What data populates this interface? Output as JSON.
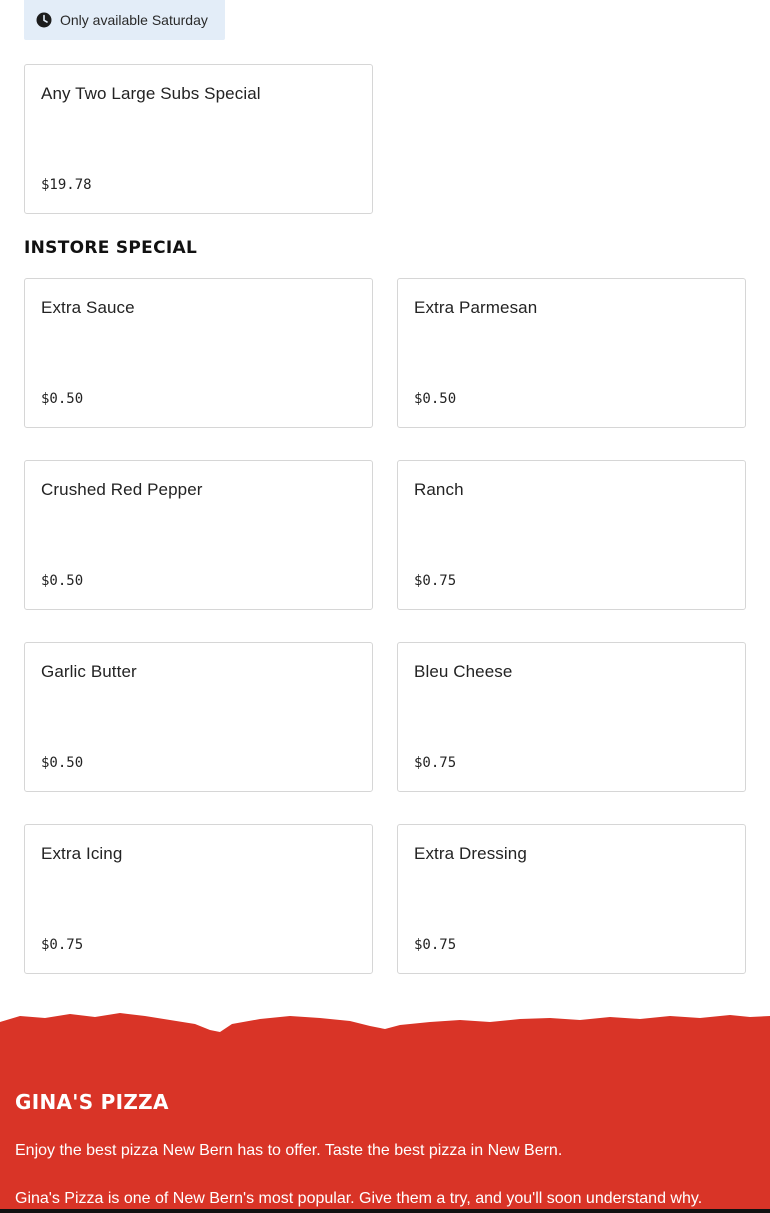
{
  "availability": {
    "icon": "clock-icon",
    "text": "Only available Saturday"
  },
  "special_items": [
    {
      "name": "Any Two Large Subs Special",
      "price": "$19.78"
    }
  ],
  "instore_section": {
    "title": "INSTORE SPECIAL",
    "items": [
      {
        "name": "Extra Sauce",
        "price": "$0.50"
      },
      {
        "name": "Extra Parmesan",
        "price": "$0.50"
      },
      {
        "name": "Crushed Red Pepper",
        "price": "$0.50"
      },
      {
        "name": "Ranch",
        "price": "$0.75"
      },
      {
        "name": "Garlic Butter",
        "price": "$0.50"
      },
      {
        "name": "Bleu Cheese",
        "price": "$0.75"
      },
      {
        "name": "Extra Icing",
        "price": "$0.75"
      },
      {
        "name": "Extra Dressing",
        "price": "$0.75"
      }
    ]
  },
  "footer": {
    "brand": "GINA'S PIZZA",
    "tagline": "Enjoy the best pizza New Bern has to offer. Taste the best pizza in New Bern.",
    "description": "Gina's Pizza is one of New Bern's most popular. Give them a try, and you'll soon understand why."
  },
  "colors": {
    "footer_red": "#d93427",
    "availability_bg": "#e3edf8",
    "card_border": "#d6d6d6"
  }
}
